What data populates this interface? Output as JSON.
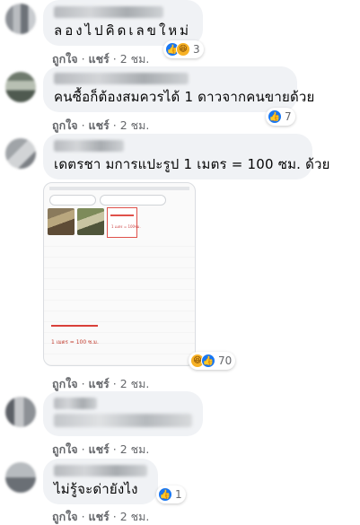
{
  "comments": [
    {
      "text": "ลองไปคิดเลขใหม่",
      "actions": {
        "like": "ถูกใจ",
        "reply": "แชร์",
        "time": "2 ชม."
      },
      "reaction_count": "3",
      "reaction_types": [
        "like-icon",
        "haha-icon"
      ]
    },
    {
      "text": "คนซื้อก็ต้องสมควรได้ 1 ดาวจากคนขายด้วย",
      "actions": {
        "like": "ถูกใจ",
        "reply": "แชร์",
        "time": "2 ชม."
      },
      "reaction_count": "7",
      "reaction_types": [
        "like-icon"
      ]
    },
    {
      "text": "เดตรชา มการแปะรูป 1 เมตร = 100 ซม. ด้วย",
      "actions": {
        "like": "ถูกใจ",
        "reply": "แชร์",
        "time": "2 ชม."
      },
      "reaction_count": "70",
      "reaction_types": [
        "haha-icon",
        "like-icon"
      ],
      "image": {
        "box_label": "1 เมตร = 100ซม.",
        "caption": "1 เมตร = 100 ซ.ม."
      }
    },
    {
      "text": "",
      "actions": {
        "like": "ถูกใจ",
        "reply": "แชร์",
        "time": "2 ชม."
      }
    },
    {
      "text": "ไม่รู้จะด่ายังไง",
      "actions": {
        "like": "ถูกใจ",
        "reply": "แชร์",
        "time": "2 ชม."
      },
      "reaction_count": "1",
      "reaction_types": [
        "like-icon"
      ]
    }
  ],
  "colors": {
    "bubble": "#f0f2f5",
    "meta": "#65676b",
    "like": "#1877f2",
    "haha": "#f7b125",
    "accent_red": "#d9403a"
  }
}
